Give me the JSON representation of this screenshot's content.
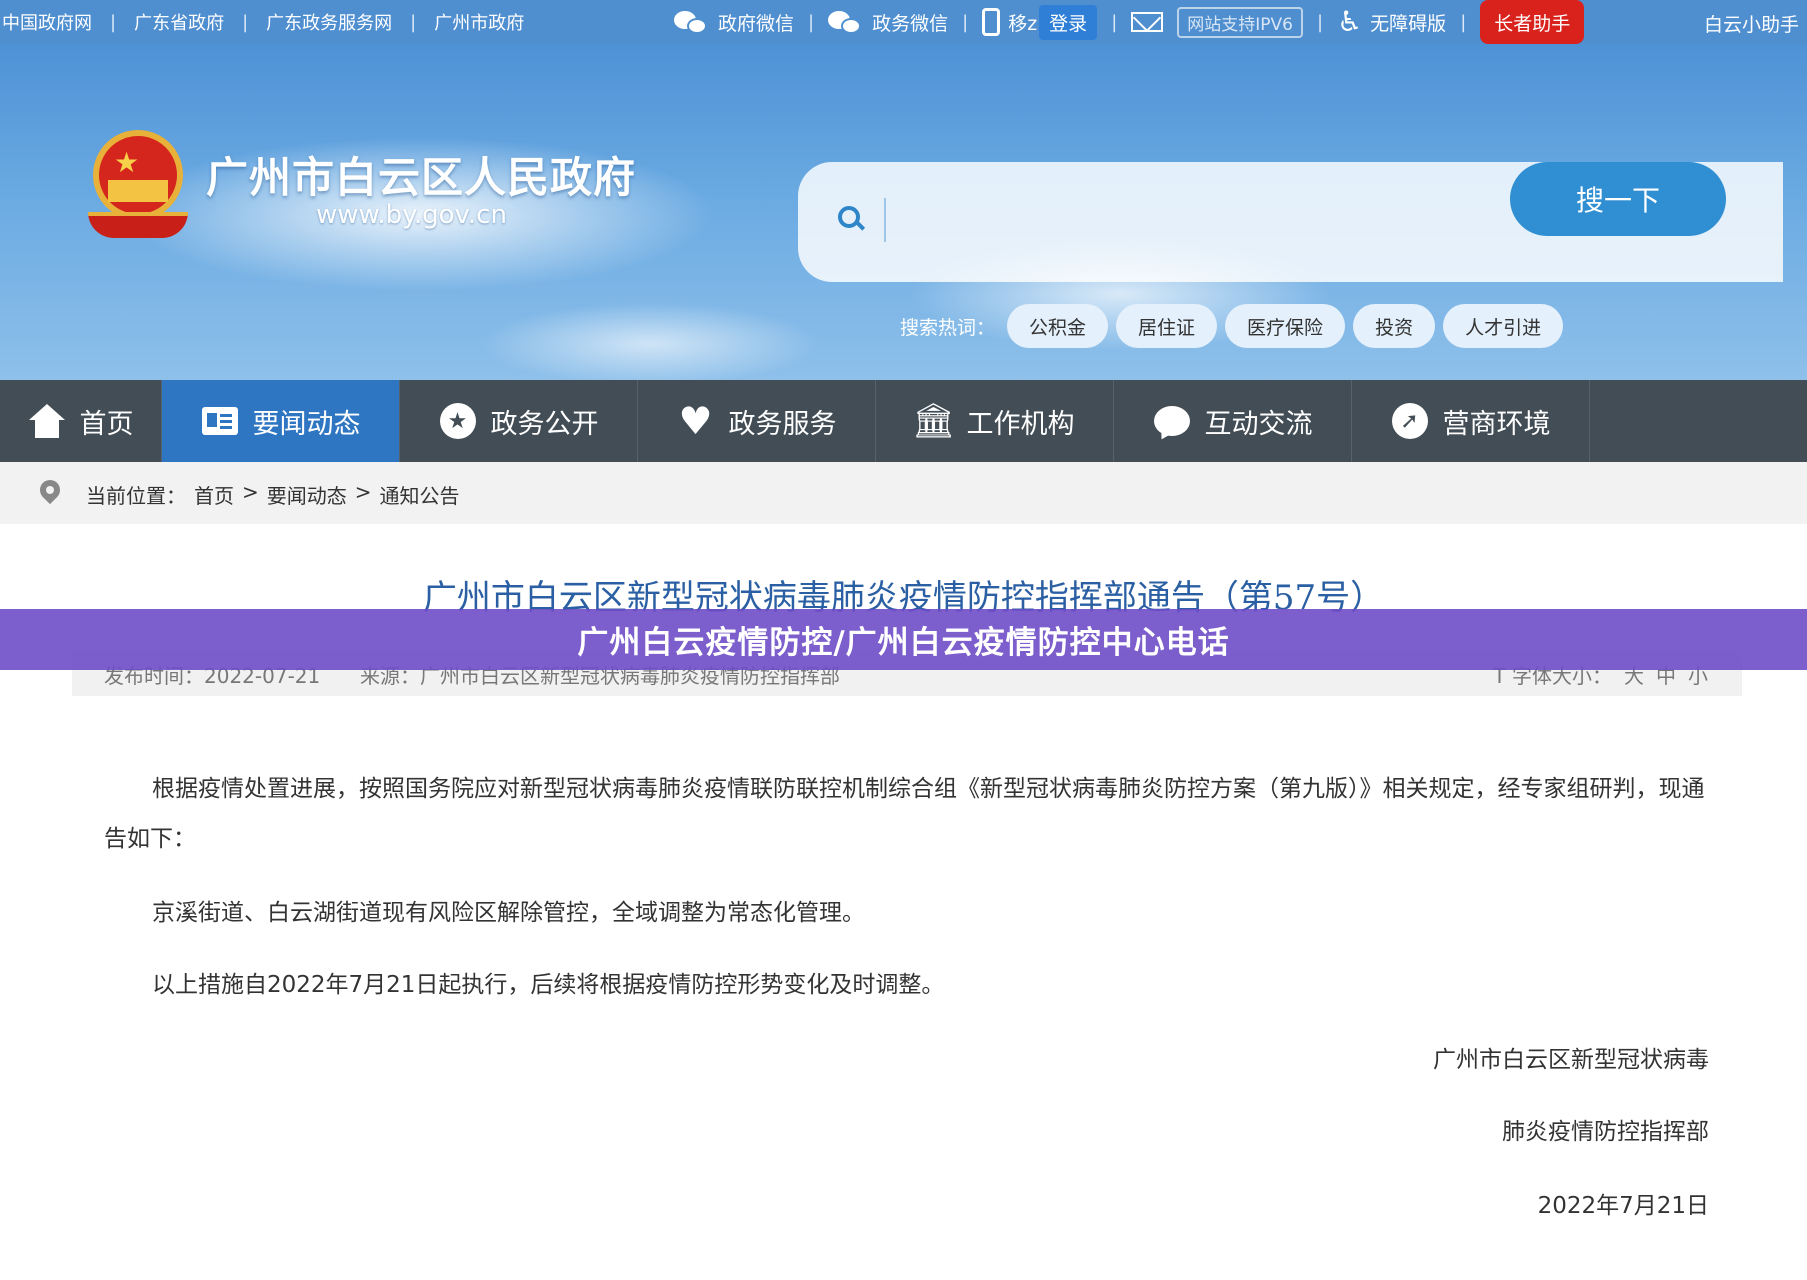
{
  "topbar": {
    "links": [
      "中国政府网",
      "广东省政府",
      "广东政务服务网",
      "广州市政府"
    ],
    "wechat": "政府微信",
    "service_wechat": "政务微信",
    "mobile_prefix": "移z",
    "login": "登录",
    "ipv6": "网站支持IPV6",
    "accessible": "无障碍版",
    "elder": "长者助手",
    "mini_program": "白云小助手"
  },
  "banner": {
    "title": "广州市白云区人民政府",
    "domain": "www.by.gov.cn",
    "search_placeholder": "",
    "search_button": "搜一下",
    "hot_label": "搜索热词：",
    "hot_words": [
      "公积金",
      "居住证",
      "医疗保险",
      "投资",
      "人才引进"
    ]
  },
  "nav": {
    "items": [
      {
        "label": "首页",
        "icon": "home-icon"
      },
      {
        "label": "要闻动态",
        "icon": "news-icon"
      },
      {
        "label": "政务公开",
        "icon": "star-icon"
      },
      {
        "label": "政务服务",
        "icon": "heart-icon"
      },
      {
        "label": "工作机构",
        "icon": "building-icon"
      },
      {
        "label": "互动交流",
        "icon": "chat-icon"
      },
      {
        "label": "营商环境",
        "icon": "business-icon"
      }
    ],
    "active_index": 1
  },
  "breadcrumb": {
    "label": "当前位置：",
    "items": [
      "首页",
      "要闻动态",
      "通知公告"
    ],
    "sep": ">"
  },
  "article": {
    "title": "广州市白云区新型冠状病毒肺炎疫情防控指挥部通告（第57号）",
    "publish": "发布时间：2022-07-21",
    "source": "来源：广州市白云区新型冠状病毒肺炎疫情防控指挥部",
    "font_size_label": "T 字体大小：",
    "font_sizes": [
      "大",
      "中",
      "小"
    ],
    "p1": "根据疫情处置进展，按照国务院应对新型冠状病毒肺炎疫情联防联控机制综合组《新型冠状病毒肺炎防控方案（第九版）》相关规定，经专家组研判，现通告如下：",
    "p2": "京溪街道、白云湖街道现有风险区解除管控，全域调整为常态化管理。",
    "p3": "以上措施自2022年7月21日起执行，后续将根据疫情防控形势变化及时调整。",
    "sign1": "广州市白云区新型冠状病毒",
    "sign2": "肺炎疫情防控指挥部",
    "date": "2022年7月21日"
  },
  "overlay": {
    "text": "广州白云疫情防控/广州白云疫情防控中心电话"
  },
  "colors": {
    "topbar": "#4f8fd0",
    "nav": "#424d55",
    "nav_active": "#2f76c2",
    "elder": "#d9221c",
    "overlay": "#6e4cc8",
    "title": "#2b5fa3"
  }
}
